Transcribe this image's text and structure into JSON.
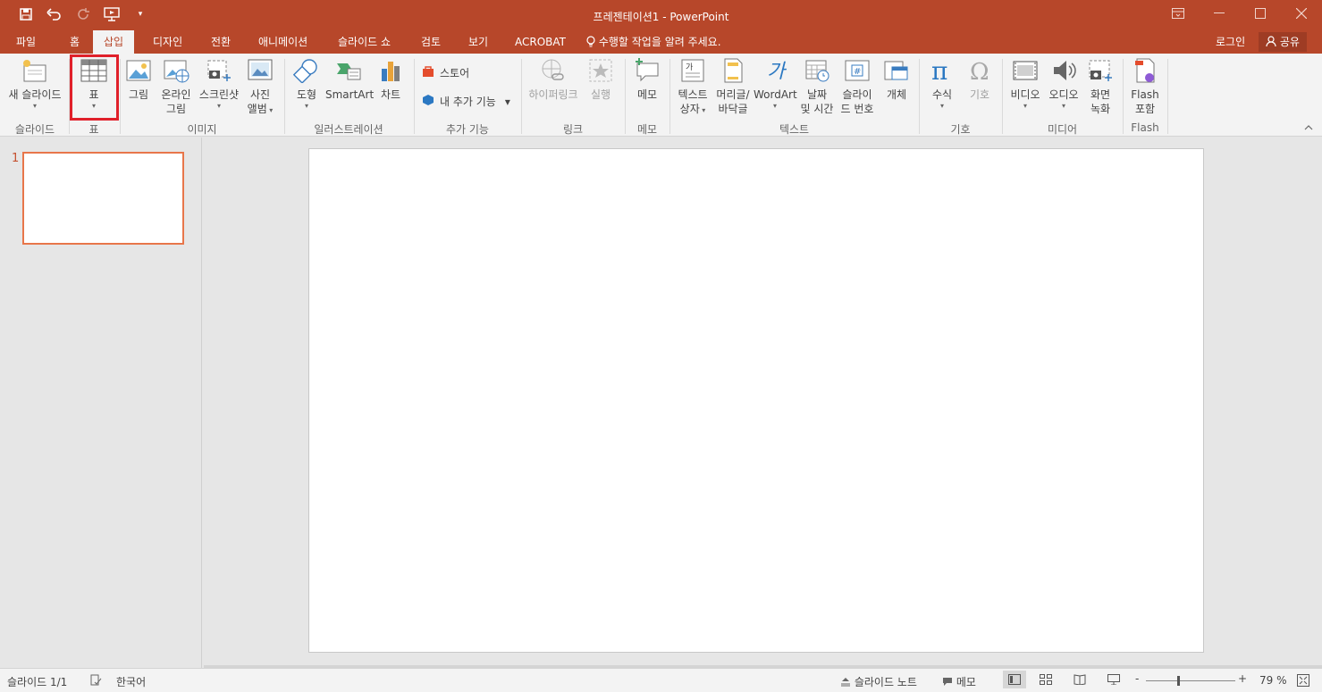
{
  "window": {
    "title": "프레젠테이션1 - PowerPoint",
    "controls": [
      "restore-ribbon-icon",
      "minimize-icon",
      "maximize-icon",
      "close-icon"
    ]
  },
  "qat": {
    "items": [
      "save-icon",
      "undo-icon",
      "redo-icon",
      "start-from-beginning-icon",
      "customize-qat-icon"
    ]
  },
  "tabs": [
    {
      "label": "파일",
      "active": false
    },
    {
      "label": "홈",
      "active": false
    },
    {
      "label": "삽입",
      "active": true
    },
    {
      "label": "디자인",
      "active": false
    },
    {
      "label": "전환",
      "active": false
    },
    {
      "label": "애니메이션",
      "active": false
    },
    {
      "label": "슬라이드 쇼",
      "active": false
    },
    {
      "label": "검토",
      "active": false
    },
    {
      "label": "보기",
      "active": false
    },
    {
      "label": "ACROBAT",
      "active": false
    }
  ],
  "tell_me": "수행할 작업을 알려 주세요.",
  "account": {
    "login": "로그인",
    "share": "공유"
  },
  "ribbon": {
    "groups": {
      "slides": "슬라이드",
      "tables": "표",
      "images": "이미지",
      "illustrations": "일러스트레이션",
      "addins": "추가 기능",
      "links": "링크",
      "comments": "메모",
      "text": "텍스트",
      "symbols": "기호",
      "media": "미디어",
      "flash": "Flash"
    },
    "buttons": {
      "new_slide": "새 슬라이드",
      "table": "표",
      "pictures": "그림",
      "online_pictures_1": "온라인",
      "online_pictures_2": "그림",
      "screenshot": "스크린샷",
      "photo_album_1": "사진",
      "photo_album_2": "앨범",
      "shapes": "도형",
      "smartart": "SmartArt",
      "chart": "차트",
      "store": "스토어",
      "my_addins": "내 추가 기능",
      "hyperlink": "하이퍼링크",
      "action": "실행",
      "comment": "메모",
      "textbox_1": "텍스트",
      "textbox_2": "상자",
      "header_footer_1": "머리글/",
      "header_footer_2": "바닥글",
      "wordart": "WordArt",
      "datetime_1": "날짜",
      "datetime_2": "및 시간",
      "slide_number_1": "슬라이",
      "slide_number_2": "드 번호",
      "object": "개체",
      "equation": "수식",
      "symbol": "기호",
      "video": "비디오",
      "audio": "오디오",
      "screen_rec_1": "화면",
      "screen_rec_2": "녹화",
      "flash_1": "Flash",
      "flash_2": "포함"
    }
  },
  "thumbnails": {
    "slide_number": "1"
  },
  "status": {
    "slide_pos": "슬라이드 1/1",
    "language": "한국어",
    "notes": "슬라이드 노트",
    "comments": "메모",
    "zoom": "79 %",
    "zoom_minus": "-",
    "zoom_plus": "+"
  },
  "colors": {
    "accent": "#b7472a",
    "highlight_box": "#e0202a",
    "thumb_border": "#e8764a"
  }
}
